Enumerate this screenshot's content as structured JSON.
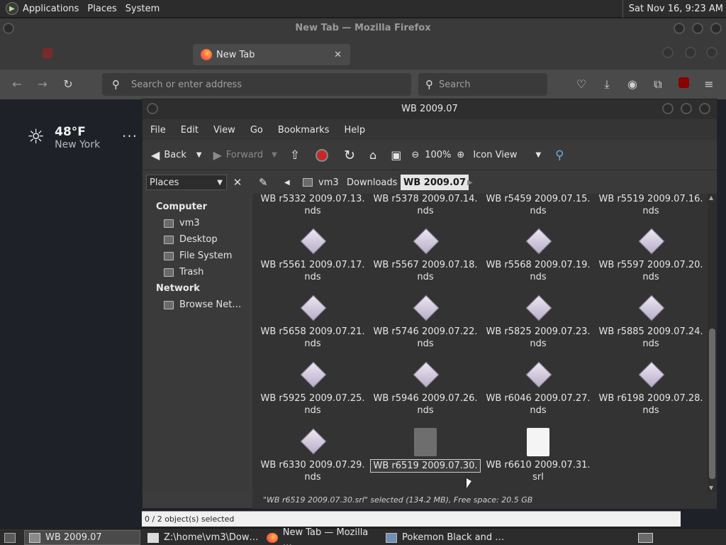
{
  "top_panel": {
    "menus": [
      "Applications",
      "Places",
      "System"
    ],
    "clock": "Sat Nov 16,  9:23 AM"
  },
  "firefox": {
    "window_title": "New Tab — Mozilla Firefox",
    "active_tab": "New Tab",
    "url_placeholder": "Search or enter address",
    "search_placeholder": "Search",
    "status_bar": "0 / 2 object(s) selected"
  },
  "weather": {
    "temp": "48°F",
    "city": "New York",
    "more": "···"
  },
  "file_manager": {
    "title": "WB 2009.07",
    "menu": [
      "File",
      "Edit",
      "View",
      "Go",
      "Bookmarks",
      "Help"
    ],
    "toolbar": {
      "back": "Back",
      "forward": "Forward",
      "zoom": "100%",
      "view_mode": "Icon View"
    },
    "places_label": "Places",
    "breadcrumbs": [
      "vm3",
      "Downloads",
      "WB 2009.07"
    ],
    "sidebar": {
      "computer_heading": "Computer",
      "computer_items": [
        "vm3",
        "Desktop",
        "File System",
        "Trash"
      ],
      "network_heading": "Network",
      "network_items": [
        "Browse Net…"
      ]
    },
    "files": [
      {
        "name": "WB r5332 2009.07.13.",
        "ext": "nds"
      },
      {
        "name": "WB r5378 2009.07.14.",
        "ext": "nds"
      },
      {
        "name": "WB r5459 2009.07.15.",
        "ext": "nds"
      },
      {
        "name": "WB r5519 2009.07.16.",
        "ext": "nds"
      },
      {
        "name": "WB r5561 2009.07.17.",
        "ext": "nds"
      },
      {
        "name": "WB r5567 2009.07.18.",
        "ext": "nds"
      },
      {
        "name": "WB r5568 2009.07.19.",
        "ext": "nds"
      },
      {
        "name": "WB r5597 2009.07.20.",
        "ext": "nds"
      },
      {
        "name": "WB r5658 2009.07.21.",
        "ext": "nds"
      },
      {
        "name": "WB r5746 2009.07.22.",
        "ext": "nds"
      },
      {
        "name": "WB r5825 2009.07.23.",
        "ext": "nds"
      },
      {
        "name": "WB r5885 2009.07.24.",
        "ext": "nds"
      },
      {
        "name": "WB r5925 2009.07.25.",
        "ext": "nds"
      },
      {
        "name": "WB r5946 2009.07.26.",
        "ext": "nds"
      },
      {
        "name": "WB r6046 2009.07.27.",
        "ext": "nds"
      },
      {
        "name": "WB r6198 2009.07.28.",
        "ext": "nds"
      },
      {
        "name": "WB r6330 2009.07.29.",
        "ext": "nds"
      },
      {
        "name": "WB r6519 2009.07.30.",
        "ext": ""
      },
      {
        "name": "WB r6610 2009.07.31.",
        "ext": "srl"
      }
    ],
    "status": "\"WB r6519 2009.07.30.srl\" selected (134.2 MB), Free space: 20.5 GB"
  },
  "taskbar": {
    "items": [
      "WB 2009.07",
      "Z:\\home\\vm3\\Dow…",
      "New Tab — Mozilla …",
      "Pokemon Black and …"
    ]
  }
}
